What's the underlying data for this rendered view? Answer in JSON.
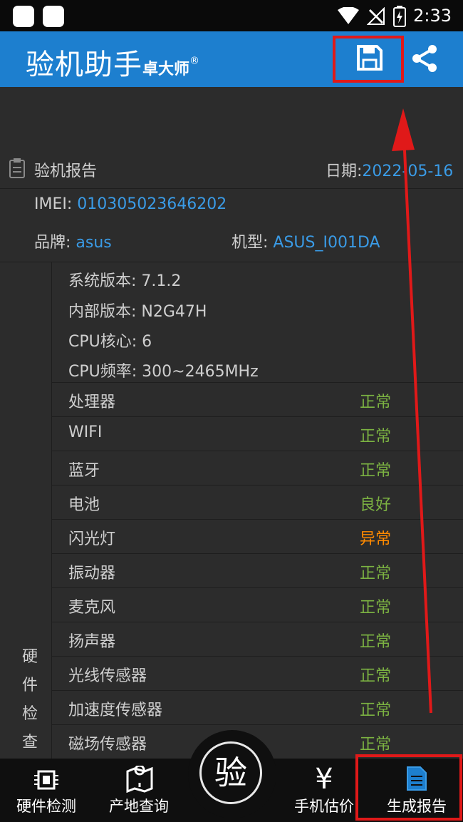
{
  "status_bar": {
    "time": "2:33"
  },
  "app_bar": {
    "title": "验机助手",
    "subtitle": "卓大师",
    "registered_mark": "®"
  },
  "report": {
    "header_label": "验机报告",
    "date_label": "日期:",
    "date_value": "2022-05-16",
    "imei_label": "IMEI:",
    "imei_value": "010305023646202",
    "brand_label": "品牌:",
    "brand_value": "asus",
    "model_label": "机型:",
    "model_value": "ASUS_I001DA"
  },
  "system_info": [
    {
      "label": "系统版本:",
      "value": "7.1.2"
    },
    {
      "label": "内部版本:",
      "value": "N2G47H"
    },
    {
      "label": "CPU核心:",
      "value": "6"
    },
    {
      "label": "CPU频率:",
      "value": "300~2465MHz"
    }
  ],
  "hardware_section_label": [
    "硬",
    "件",
    "检",
    "查"
  ],
  "hardware_items": [
    {
      "name": "处理器",
      "status": "正常"
    },
    {
      "name": "WIFI",
      "status": "正常"
    },
    {
      "name": "蓝牙",
      "status": "正常"
    },
    {
      "name": "电池",
      "status": "良好"
    },
    {
      "name": "闪光灯",
      "status": "异常"
    },
    {
      "name": "振动器",
      "status": "正常"
    },
    {
      "name": "麦克风",
      "status": "正常"
    },
    {
      "name": "扬声器",
      "status": "正常"
    },
    {
      "name": "光线传感器",
      "status": "正常"
    },
    {
      "name": "加速度传感器",
      "status": "正常"
    },
    {
      "name": "磁场传感器",
      "status": "正常"
    }
  ],
  "bottom_nav": {
    "hardware": "硬件检测",
    "location": "产地查询",
    "center": "验",
    "price": "手机估价",
    "report": "生成报告"
  },
  "colors": {
    "primary": "#1d7fcf",
    "ok": "#7cb342",
    "abnormal": "#ff8a00",
    "highlight": "#e01919"
  }
}
